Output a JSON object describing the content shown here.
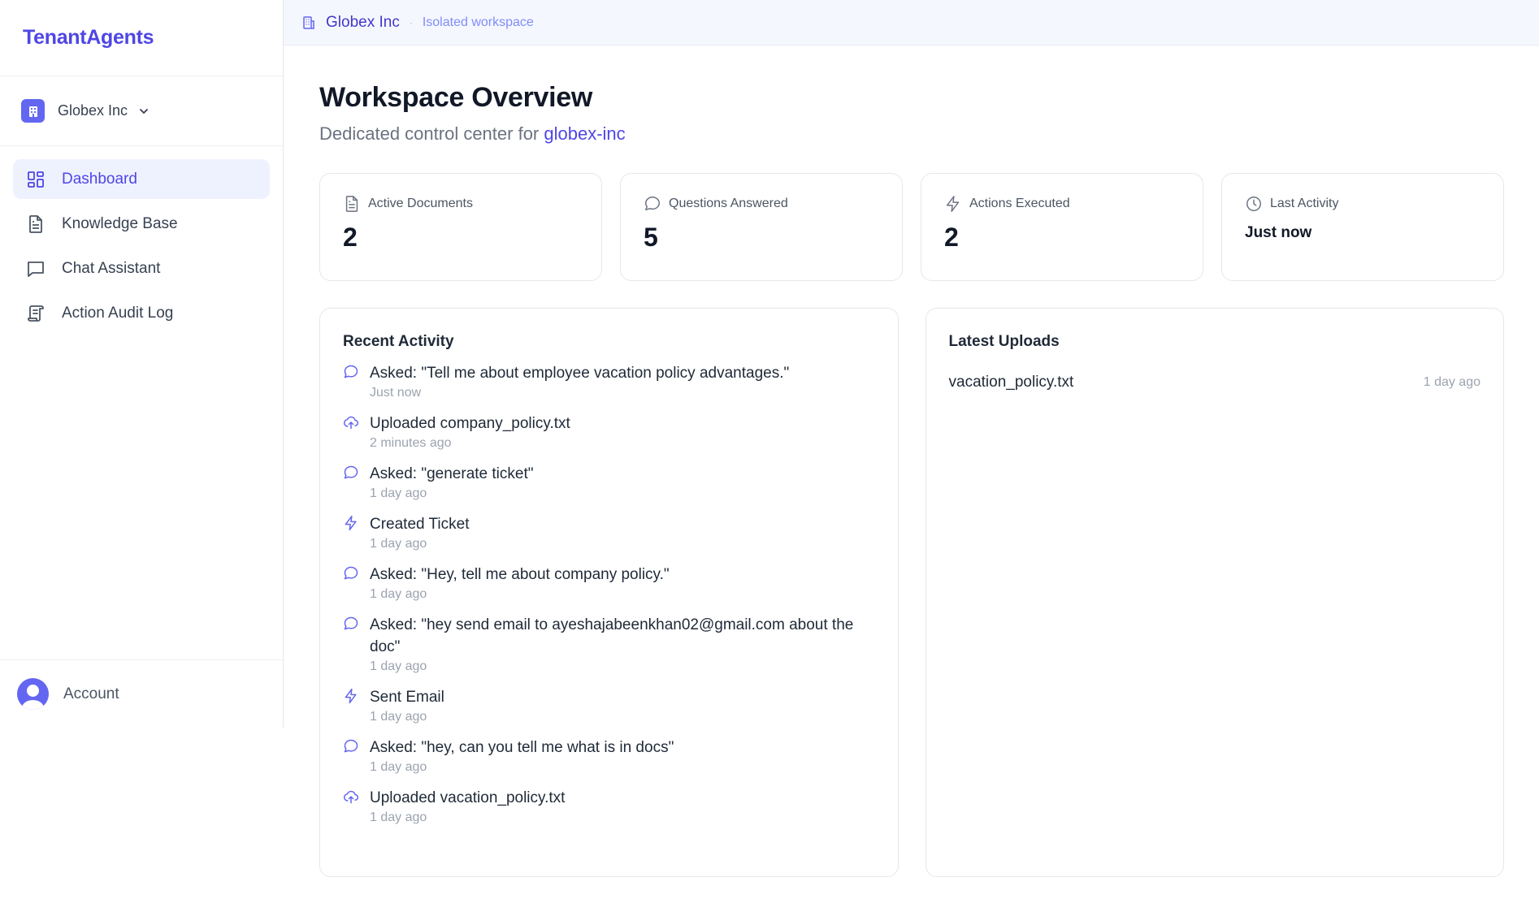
{
  "brand": {
    "name": "TenantAgents",
    "color": "#4f46e5"
  },
  "tenant": {
    "name": "Globex Inc",
    "icon": "building-icon"
  },
  "sidebar": {
    "items": [
      {
        "label": "Dashboard",
        "icon": "dashboard-icon",
        "active": true
      },
      {
        "label": "Knowledge Base",
        "icon": "document-icon",
        "active": false
      },
      {
        "label": "Chat Assistant",
        "icon": "chat-icon",
        "active": false
      },
      {
        "label": "Action Audit Log",
        "icon": "scroll-icon",
        "active": false
      }
    ],
    "account_label": "Account"
  },
  "topbar": {
    "workspace_name": "Globex Inc",
    "separator": "·",
    "subtitle": "Isolated workspace"
  },
  "page": {
    "title": "Workspace Overview",
    "subtitle_prefix": "Dedicated control center for ",
    "slug": "globex-inc"
  },
  "stats": [
    {
      "label": "Active Documents",
      "value": "2",
      "icon": "document-icon"
    },
    {
      "label": "Questions Answered",
      "value": "5",
      "icon": "chat-icon"
    },
    {
      "label": "Actions Executed",
      "value": "2",
      "icon": "lightning-icon"
    },
    {
      "label": "Last Activity",
      "value": "Just now",
      "icon": "clock-icon"
    }
  ],
  "recent_activity": {
    "title": "Recent Activity",
    "items": [
      {
        "type": "question",
        "icon": "chat-icon",
        "text": "Asked: \"Tell me about employee vacation policy advantages.\"",
        "time": "Just now"
      },
      {
        "type": "upload",
        "icon": "upload-cloud-icon",
        "text": "Uploaded company_policy.txt",
        "time": "2 minutes ago"
      },
      {
        "type": "question",
        "icon": "chat-icon",
        "text": "Asked: \"generate ticket\"",
        "time": "1 day ago"
      },
      {
        "type": "action",
        "icon": "lightning-icon",
        "text": "Created Ticket",
        "time": "1 day ago"
      },
      {
        "type": "question",
        "icon": "chat-icon",
        "text": "Asked: \"Hey, tell me about company policy.\"",
        "time": "1 day ago"
      },
      {
        "type": "question",
        "icon": "chat-icon",
        "text": "Asked: \"hey send email to ayeshajabeenkhan02@gmail.com about the doc\"",
        "time": "1 day ago"
      },
      {
        "type": "action",
        "icon": "lightning-icon",
        "text": "Sent Email",
        "time": "1 day ago"
      },
      {
        "type": "question",
        "icon": "chat-icon",
        "text": "Asked: \"hey, can you tell me what is in docs\"",
        "time": "1 day ago"
      },
      {
        "type": "upload",
        "icon": "upload-cloud-icon",
        "text": "Uploaded vacation_policy.txt",
        "time": "1 day ago"
      }
    ]
  },
  "latest_uploads": {
    "title": "Latest Uploads",
    "items": [
      {
        "name": "vacation_policy.txt",
        "time": "1 day ago"
      }
    ]
  },
  "colors": {
    "accent": "#4f46e5",
    "accent_light": "#6366f1",
    "active_bg": "#eef2ff",
    "topbar_bg": "#f5f7ff",
    "muted_text": "#9ca3af"
  }
}
